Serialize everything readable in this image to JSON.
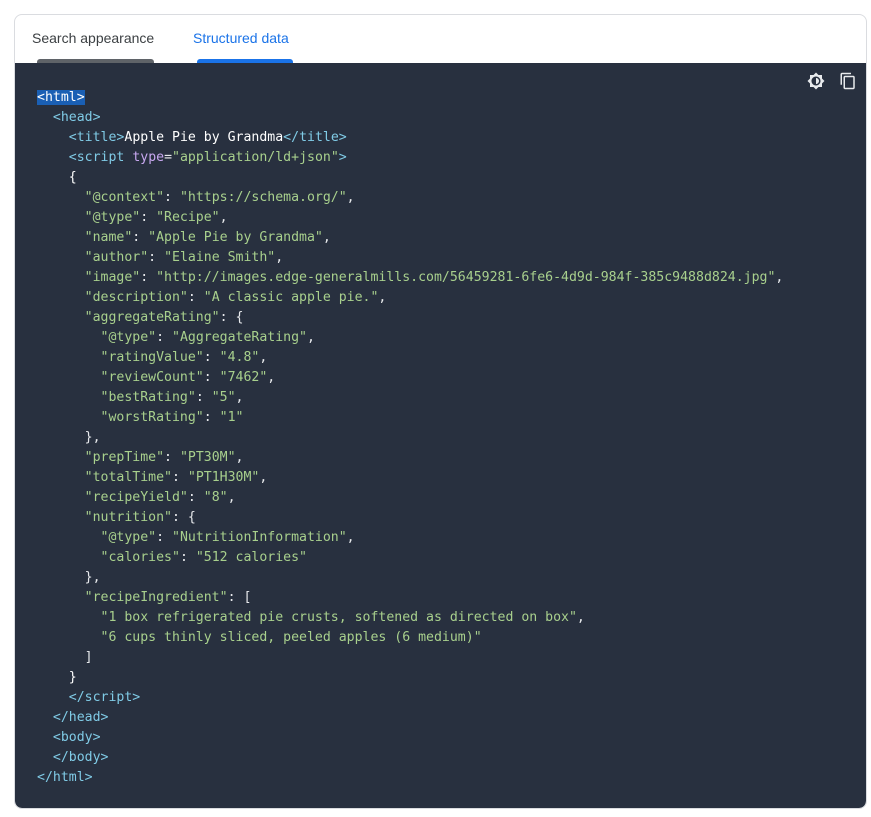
{
  "tabs": [
    {
      "label": "Search appearance",
      "selected": false
    },
    {
      "label": "Structured data",
      "selected": true
    }
  ],
  "toolbar": {
    "theme_icon": "theme-toggle-icon",
    "copy_icon": "copy-icon"
  },
  "colors": {
    "accent": "#1a73e8",
    "code_bg": "#28303f",
    "tag": "#80cbe6",
    "attr": "#c8a8f0",
    "string": "#a8d08d"
  },
  "code": {
    "html_open": "html",
    "head_open": "head",
    "title_tag": "title",
    "title_text": "Apple Pie by Grandma",
    "script_tag": "script",
    "script_attr": "type",
    "script_attr_value": "\"application/ld+json\"",
    "context_key": "\"@context\"",
    "context_val": "\"https://schema.org/\"",
    "type_key": "\"@type\"",
    "type_val": "\"Recipe\"",
    "name_key": "\"name\"",
    "name_val": "\"Apple Pie by Grandma\"",
    "author_key": "\"author\"",
    "author_val": "\"Elaine Smith\"",
    "image_key": "\"image\"",
    "image_val": "\"http://images.edge-generalmills.com/56459281-6fe6-4d9d-984f-385c9488d824.jpg\"",
    "description_key": "\"description\"",
    "description_val": "\"A classic apple pie.\"",
    "aggregate_key": "\"aggregateRating\"",
    "agg_type_key": "\"@type\"",
    "agg_type_val": "\"AggregateRating\"",
    "rating_value_key": "\"ratingValue\"",
    "rating_value_val": "\"4.8\"",
    "review_count_key": "\"reviewCount\"",
    "review_count_val": "\"7462\"",
    "best_rating_key": "\"bestRating\"",
    "best_rating_val": "\"5\"",
    "worst_rating_key": "\"worstRating\"",
    "worst_rating_val": "\"1\"",
    "prep_time_key": "\"prepTime\"",
    "prep_time_val": "\"PT30M\"",
    "total_time_key": "\"totalTime\"",
    "total_time_val": "\"PT1H30M\"",
    "recipe_yield_key": "\"recipeYield\"",
    "recipe_yield_val": "\"8\"",
    "nutrition_key": "\"nutrition\"",
    "nutr_type_key": "\"@type\"",
    "nutr_type_val": "\"NutritionInformation\"",
    "calories_key": "\"calories\"",
    "calories_val": "\"512 calories\"",
    "ingredient_key": "\"recipeIngredient\"",
    "ingredient_1": "\"1 box refrigerated pie crusts, softened as directed on box\"",
    "ingredient_2": "\"6 cups thinly sliced, peeled apples (6 medium)\"",
    "body_tag": "body"
  }
}
